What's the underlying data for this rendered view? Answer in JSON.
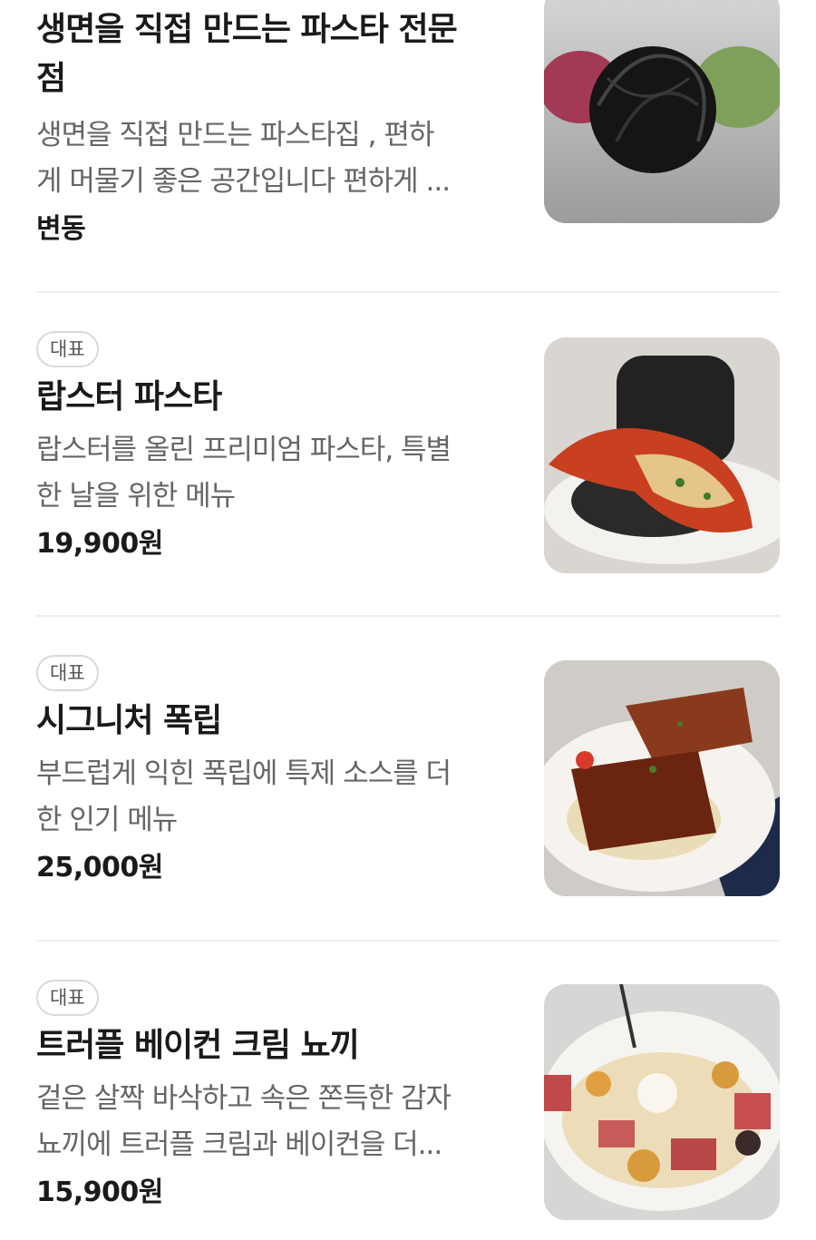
{
  "items": [
    {
      "title": "생면을 직접 만드는 파스타 전문점",
      "title_line1": "생면을 직접 만드는 파스타 전문",
      "title_line2": "점",
      "desc_line1": "생면을 직접 만드는 파스타집 , 편하",
      "desc_line2": "게 머물기 좋은 공간입니다 편하게 ...",
      "price": "변동",
      "image_icon": "pasta-noodles-image"
    },
    {
      "badge": "대표",
      "title": "랍스터 파스타",
      "desc_line1": "랍스터를 올린 프리미엄 파스타, 특별",
      "desc_line2": "한 날을 위한 메뉴",
      "price": "19,900원",
      "image_icon": "lobster-pasta-image"
    },
    {
      "badge": "대표",
      "title": "시그니처 폭립",
      "desc_line1": "부드럽게 익힌 폭립에 특제 소스를 더",
      "desc_line2": "한 인기 메뉴",
      "price": "25,000원",
      "image_icon": "pork-rib-image"
    },
    {
      "badge": "대표",
      "title": "트러플 베이컨 크림 뇨끼",
      "desc_line1": "겉은 살짝 바삭하고 속은 쫀득한 감자",
      "desc_line2": "뇨끼에 트러플 크림과 베이컨을 더...",
      "price": "15,900원",
      "image_icon": "gnocchi-image"
    }
  ],
  "colors": {
    "title": "#1a1a1a",
    "description": "#666666",
    "badge_border": "#d9d9d9",
    "divider": "#eeeeee"
  }
}
